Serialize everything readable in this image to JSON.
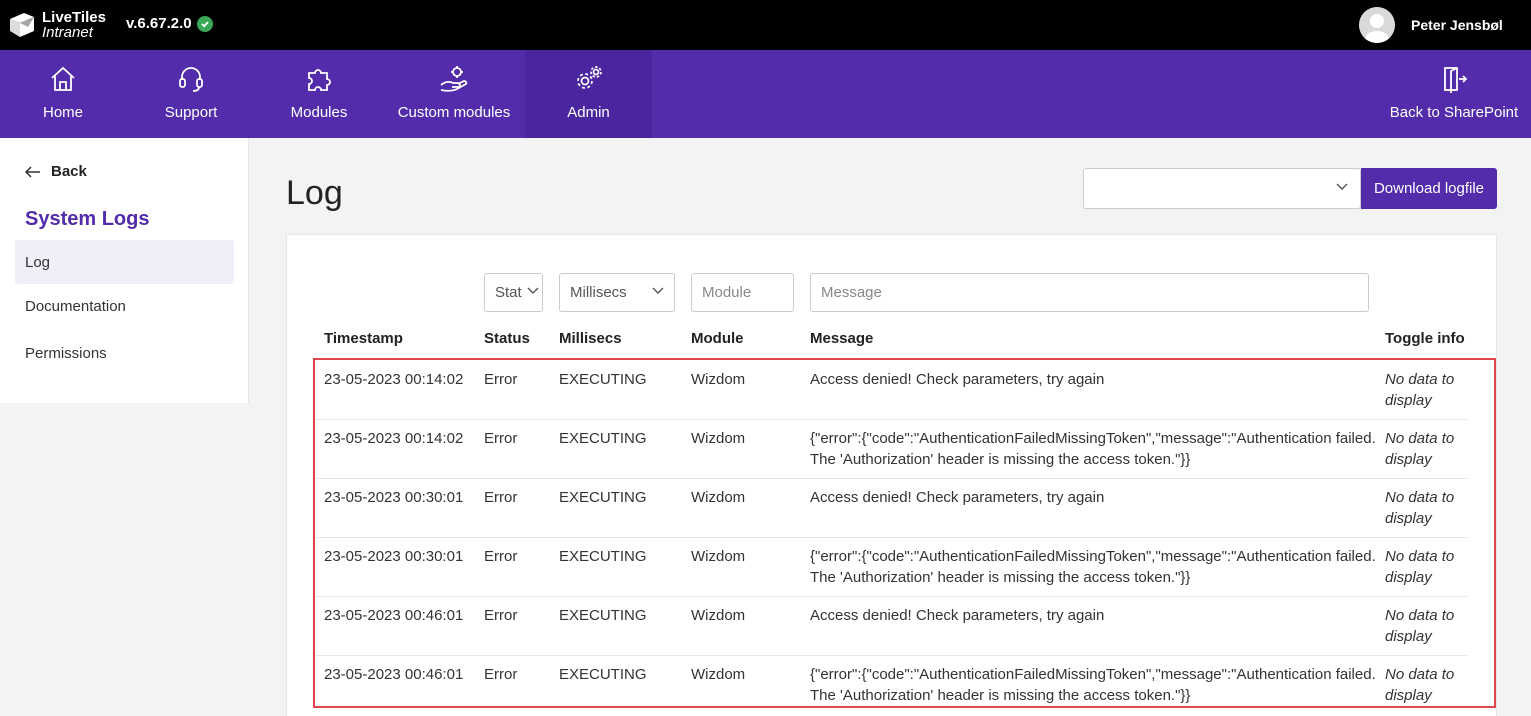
{
  "topbar": {
    "logo_line1": "LiveTiles",
    "logo_line2": "Intranet",
    "version": "v.6.67.2.0",
    "user_name": "Peter Jensbøl"
  },
  "nav": {
    "items": [
      {
        "label": "Home",
        "icon": "home-icon"
      },
      {
        "label": "Support",
        "icon": "headset-icon"
      },
      {
        "label": "Modules",
        "icon": "puzzle-icon"
      },
      {
        "label": "Custom modules",
        "icon": "hand-gear-icon"
      },
      {
        "label": "Admin",
        "icon": "gears-icon"
      }
    ],
    "back_to_sharepoint": "Back to SharePoint"
  },
  "sidebar": {
    "back_label": "Back",
    "title": "System Logs",
    "items": [
      {
        "label": "Log"
      },
      {
        "label": "Documentation"
      },
      {
        "label": "Permissions"
      }
    ]
  },
  "main": {
    "title": "Log",
    "select_value": "",
    "download_label": "Download logfile"
  },
  "filters": {
    "status": "Stat",
    "millisecs": "Millisecs",
    "module_placeholder": "Module",
    "message_placeholder": "Message"
  },
  "table": {
    "headers": [
      "Timestamp",
      "Status",
      "Millisecs",
      "Module",
      "Message",
      "Toggle info"
    ],
    "rows": [
      {
        "timestamp": "23-05-2023 00:14:02",
        "status": "Error",
        "millisecs": "EXECUTING",
        "module": "Wizdom",
        "message": "Access denied! Check parameters, try again",
        "toggle": "No data to display"
      },
      {
        "timestamp": "23-05-2023 00:14:02",
        "status": "Error",
        "millisecs": "EXECUTING",
        "module": "Wizdom",
        "message": "{\"error\":{\"code\":\"AuthenticationFailedMissingToken\",\"message\":\"Authentication failed. The 'Authorization' header is missing the access token.\"}}",
        "toggle": "No data to display"
      },
      {
        "timestamp": "23-05-2023 00:30:01",
        "status": "Error",
        "millisecs": "EXECUTING",
        "module": "Wizdom",
        "message": "Access denied! Check parameters, try again",
        "toggle": "No data to display"
      },
      {
        "timestamp": "23-05-2023 00:30:01",
        "status": "Error",
        "millisecs": "EXECUTING",
        "module": "Wizdom",
        "message": "{\"error\":{\"code\":\"AuthenticationFailedMissingToken\",\"message\":\"Authentication failed. The 'Authorization' header is missing the access token.\"}}",
        "toggle": "No data to display"
      },
      {
        "timestamp": "23-05-2023 00:46:01",
        "status": "Error",
        "millisecs": "EXECUTING",
        "module": "Wizdom",
        "message": "Access denied! Check parameters, try again",
        "toggle": "No data to display"
      },
      {
        "timestamp": "23-05-2023 00:46:01",
        "status": "Error",
        "millisecs": "EXECUTING",
        "module": "Wizdom",
        "message": "{\"error\":{\"code\":\"AuthenticationFailedMissingToken\",\"message\":\"Authentication failed. The 'Authorization' header is missing the access token.\"}}",
        "toggle": "No data to display"
      }
    ]
  },
  "colors": {
    "brand_purple": "#522cab",
    "highlight_red": "#e0474c",
    "status_ok_green": "#3aa757"
  }
}
